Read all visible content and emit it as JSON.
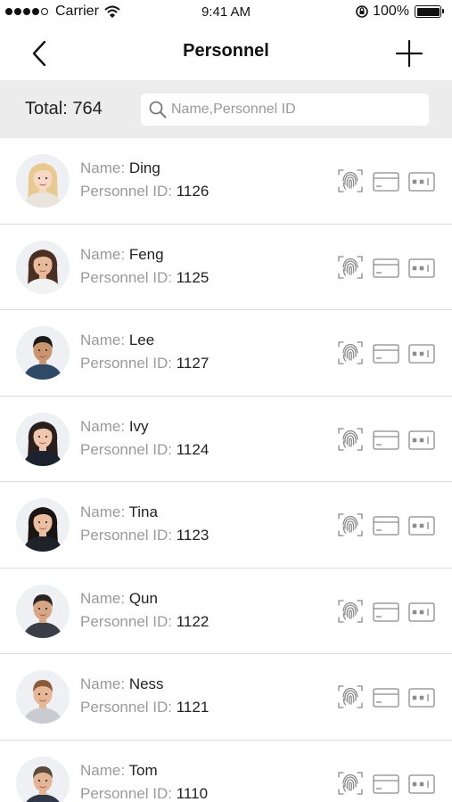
{
  "status_bar": {
    "carrier": "Carrier",
    "time": "9:41 AM",
    "battery": "100%",
    "signal_dots_filled": 4,
    "signal_dots_total": 5
  },
  "nav": {
    "title": "Personnel",
    "back_icon": "chevron-left-icon",
    "add_icon": "plus-icon"
  },
  "summary": {
    "total_label": "Total: 764"
  },
  "search": {
    "placeholder": "Name,Personnel ID",
    "value": "",
    "icon": "search-icon"
  },
  "labels": {
    "name": "Name:",
    "personnel_id": "Personnel ID:"
  },
  "personnel": [
    {
      "name": "Ding",
      "id": "1126",
      "hair": "#e8c98f",
      "skin": "#f6d8c4",
      "shirt": "#e9e4dc",
      "female": true
    },
    {
      "name": "Feng",
      "id": "1125",
      "hair": "#4a2f22",
      "skin": "#e8b99a",
      "shirt": "#f2f2f2",
      "female": true
    },
    {
      "name": "Lee",
      "id": "1127",
      "hair": "#1c1b1a",
      "skin": "#c9956f",
      "shirt": "#2f4a66",
      "female": false
    },
    {
      "name": "Ivy",
      "id": "1124",
      "hair": "#2a1f1a",
      "skin": "#efc7ae",
      "shirt": "#1d2230",
      "female": true
    },
    {
      "name": "Tina",
      "id": "1123",
      "hair": "#1a1412",
      "skin": "#e9bfa0",
      "shirt": "#1f2329",
      "female": true
    },
    {
      "name": "Qun",
      "id": "1122",
      "hair": "#2b2522",
      "skin": "#d7a687",
      "shirt": "#3b3d47",
      "female": false
    },
    {
      "name": "Ness",
      "id": "1121",
      "hair": "#8a5b3a",
      "skin": "#e6b796",
      "shirt": "#c9cbd0",
      "female": false
    },
    {
      "name": "Tom",
      "id": "1110",
      "hair": "#5a4a3c",
      "skin": "#e3b596",
      "shirt": "#30394a",
      "female": false
    }
  ],
  "credential_icons": [
    "fingerprint-icon",
    "card-icon",
    "password-icon"
  ],
  "colors": {
    "search_strip_bg": "#ececec",
    "label_gray": "#9a9a9a",
    "icon_gray": "#8a8a8a",
    "divider": "#dcdcdc"
  }
}
